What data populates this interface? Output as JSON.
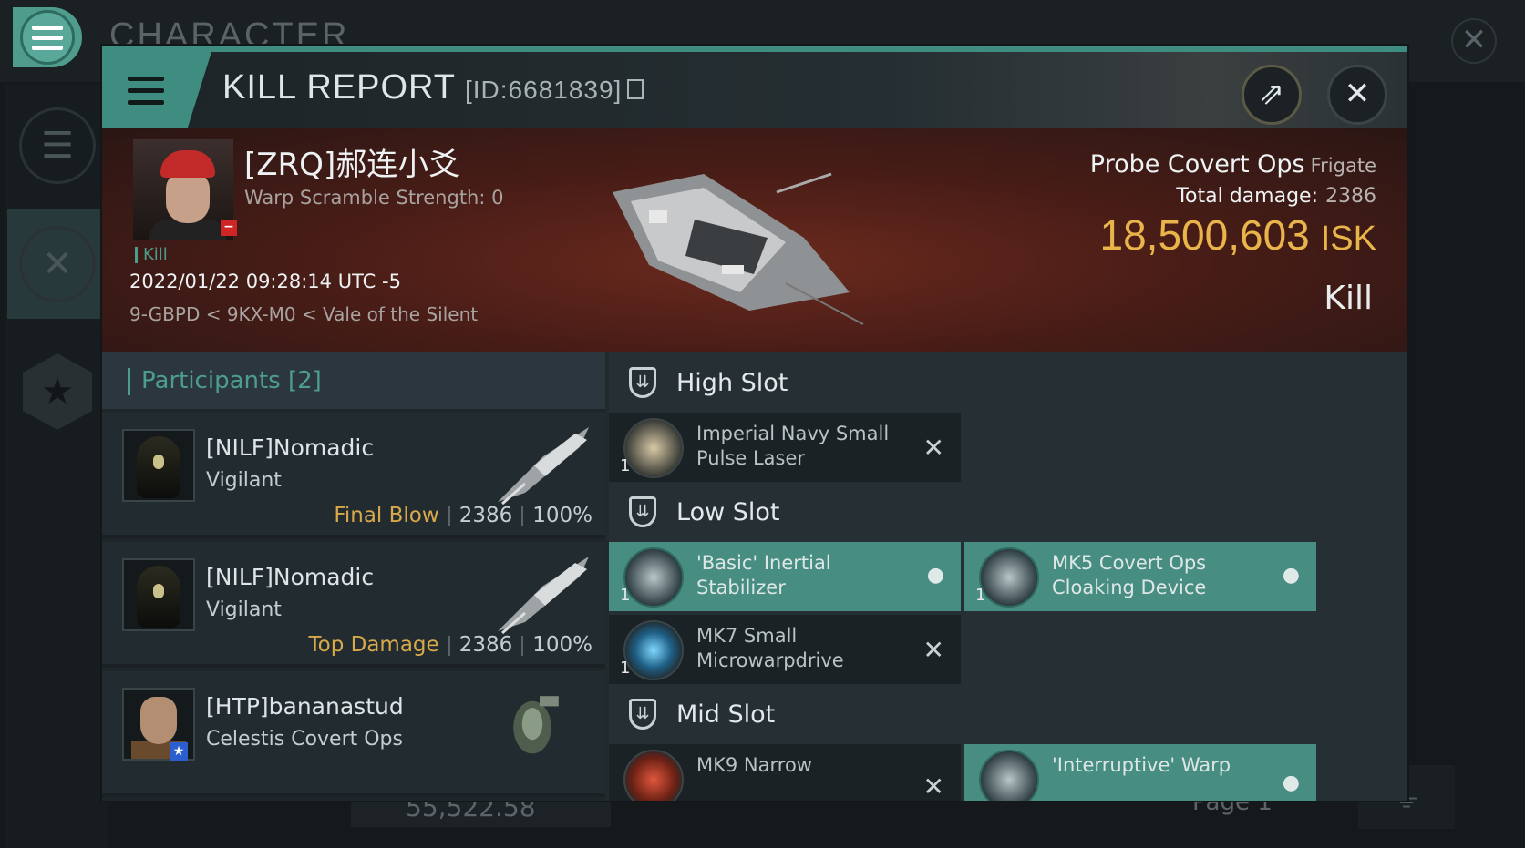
{
  "background": {
    "title": "CHARACTER",
    "bottom_value": "55,522.58",
    "page_label": "Page 1"
  },
  "modal": {
    "title": "KILL REPORT",
    "id_label": "[ID:6681839]",
    "buttons": {
      "share_icon": "share-icon",
      "close_icon": "close-icon"
    }
  },
  "victim": {
    "name": "[ZRQ]郝连小爻",
    "warp_scramble": "Warp Scramble Strength: 0",
    "tag": "Kill",
    "datetime": "2022/01/22 09:28:14 UTC -5",
    "location": "9-GBPD < 9KX-M0 < Vale of the Silent",
    "ship_name": "Probe Covert Ops",
    "ship_class": "Frigate",
    "total_damage_label": "Total damage:",
    "total_damage": "2386",
    "isk_value": "18,500,603",
    "isk_unit": "ISK",
    "result": "Kill"
  },
  "participants": {
    "header": "Participants [2]",
    "rows": [
      {
        "name": "[NILF]Nomadic",
        "ship": "Vigilant",
        "tag": "Final Blow",
        "damage": "2386",
        "percent": "100%"
      },
      {
        "name": "[NILF]Nomadic",
        "ship": "Vigilant",
        "tag": "Top Damage",
        "damage": "2386",
        "percent": "100%"
      },
      {
        "name": "[HTP]bananastud",
        "ship": "Celestis Covert Ops"
      }
    ]
  },
  "slots": {
    "high": {
      "label": "High Slot",
      "modules": [
        {
          "name_line1": "Imperial Navy Small",
          "name_line2": "Pulse Laser",
          "qty": "1",
          "status": "destroyed"
        }
      ]
    },
    "low": {
      "label": "Low Slot",
      "modules": [
        {
          "name_line1": "'Basic' Inertial",
          "name_line2": "Stabilizer",
          "qty": "1",
          "status": "dropped"
        },
        {
          "name_line1": "MK5 Covert Ops",
          "name_line2": "Cloaking Device",
          "qty": "1",
          "status": "dropped"
        },
        {
          "name_line1": "MK7 Small",
          "name_line2": "Microwarpdrive",
          "qty": "1",
          "status": "destroyed"
        }
      ]
    },
    "mid": {
      "label": "Mid Slot",
      "modules": [
        {
          "name_line1": "MK9 Narrow",
          "status": "destroyed"
        },
        {
          "name_line1": "'Interruptive' Warp",
          "status": "dropped"
        }
      ]
    }
  },
  "colors": {
    "accent": "#4f9c8d",
    "isk_gold": "#e9b44a",
    "tag_gold": "#d8a94b",
    "banner_red": "#5a2119"
  }
}
